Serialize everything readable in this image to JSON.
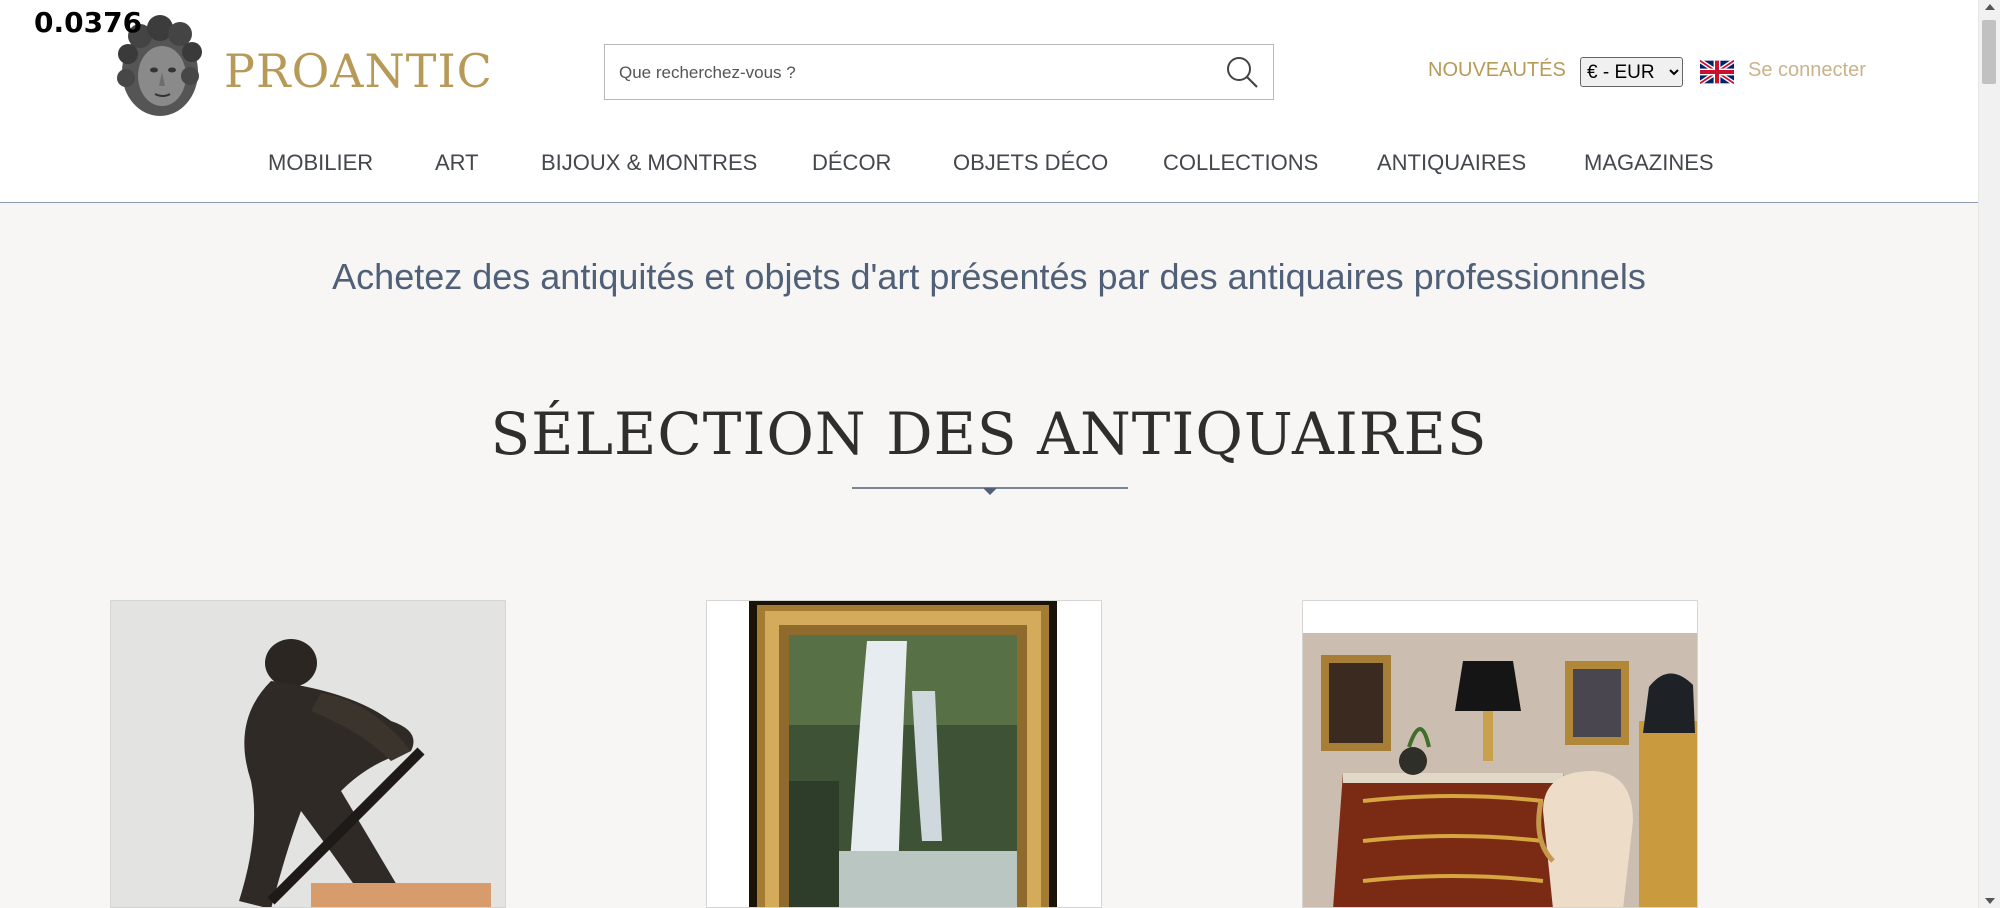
{
  "debug_value": "0.0376",
  "brand": {
    "name": "PROANTIC",
    "color": "#b89a58"
  },
  "search": {
    "placeholder": "Que recherchez-vous ?"
  },
  "header": {
    "new_label": "NOUVEAUTÉS",
    "currency_selected": "€ - EUR",
    "login_label": "Se connecter",
    "flag_icon": "uk-flag-icon"
  },
  "nav": {
    "items": [
      "MOBILIER",
      "ART",
      "BIJOUX & MONTRES",
      "DÉCOR",
      "OBJETS DÉCO",
      "COLLECTIONS",
      "ANTIQUAIRES",
      "MAGAZINES"
    ]
  },
  "main": {
    "tagline": "Achetez des antiquités et objets d'art présentés par des antiquaires professionnels",
    "section_title": "SÉLECTION DES ANTIQUAIRES"
  },
  "products": [
    {
      "image": "bronze-sculpture-man-with-shovel"
    },
    {
      "image": "framed-waterfall-painting"
    },
    {
      "image": "antique-commode-room-interior"
    }
  ]
}
